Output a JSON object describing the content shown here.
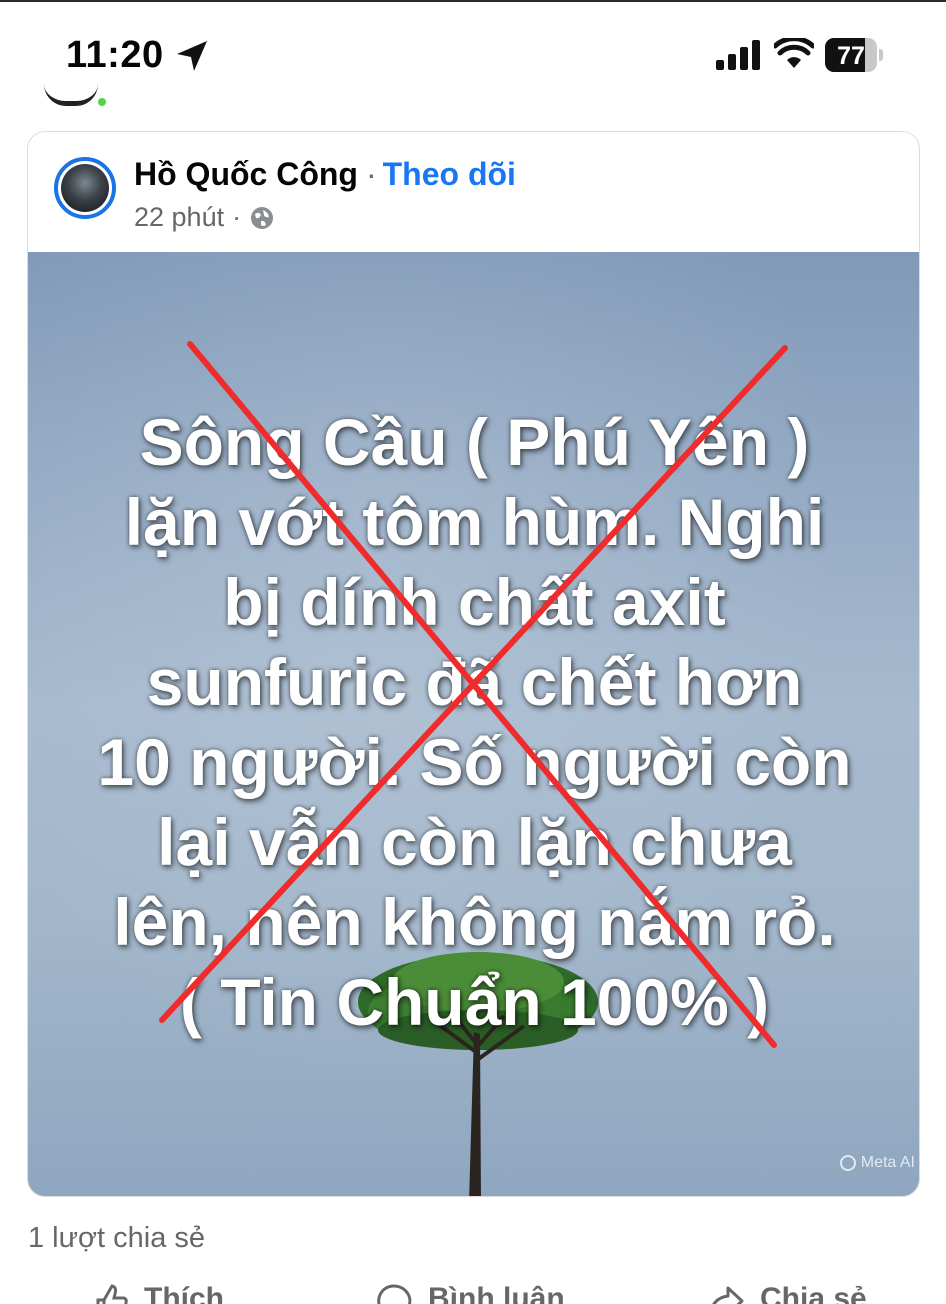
{
  "status_bar": {
    "time": "11:20",
    "battery_level": "77",
    "battery_fraction": 0.77,
    "icons": [
      "location-arrow-icon",
      "cellular-signal-icon",
      "wifi-icon",
      "battery-icon"
    ]
  },
  "post": {
    "author": "Hồ Quốc Công",
    "separator": "·",
    "follow_label": "Theo dõi",
    "time": "22 phút",
    "privacy_icon": "globe-icon",
    "image": {
      "headline": "Sông Cầu ( Phú Yên )\nlặn vớt tôm hùm. Nghi\nbị dính chất axit\nsunfuric  đã chết hơn\n10 người. Số người còn\nlại vẫn còn lặn chưa\nlên, nên không nắm rỏ.\n( Tin Chuẩn 100% )",
      "watermark": "Meta AI",
      "cross_color": "#ef2b2b"
    },
    "shares_text": "1 lượt chia sẻ",
    "actions": {
      "like": "Thích",
      "comment": "Bình luận",
      "share": "Chia sẻ"
    }
  },
  "colors": {
    "link_blue": "#1877f2",
    "secondary_text": "#65676b"
  }
}
